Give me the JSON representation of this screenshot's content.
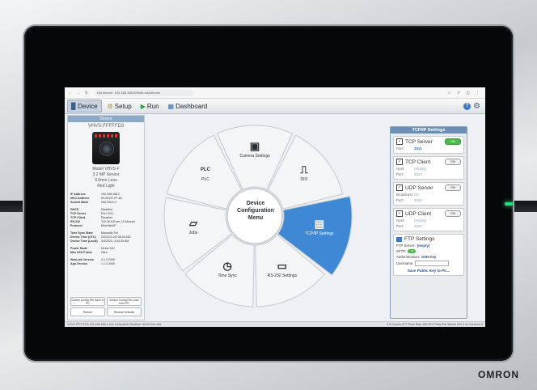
{
  "browser": {
    "url": "192.168.188.2/WebLink/#/home",
    "security": "Not secure"
  },
  "toolbar": {
    "tabs": [
      {
        "label": "Device"
      },
      {
        "label": "Setup"
      },
      {
        "label": "Run"
      },
      {
        "label": "Dashboard"
      }
    ]
  },
  "device": {
    "header": "Device",
    "name": "VHVS-FFFFFD3",
    "model_lines": [
      "Model VHVS-F",
      "3.2 MP Sensor",
      "9.6mm Lens",
      "Red Light"
    ],
    "network": [
      {
        "k": "IP Address",
        "v": "192.168.188.2"
      },
      {
        "k": "MAC Address",
        "v": "00-06-EF-FF-83"
      },
      {
        "k": "Subnet Mask",
        "v": "255.255.0.0"
      }
    ],
    "protocols": [
      {
        "k": "DHCP",
        "v": "Disabled"
      },
      {
        "k": "TCP Server",
        "v": "Port 2011"
      },
      {
        "k": "TCP Client",
        "v": "Disabled"
      },
      {
        "k": "RS-232",
        "v": "115.2K,8,Even,1,Enforced"
      },
      {
        "k": "Protocol",
        "v": "EtherNet/IP"
      }
    ],
    "time": [
      {
        "k": "Time Sync State",
        "v": "Manually Set"
      },
      {
        "k": "Device Time (UTC)",
        "v": "2023-03-04T08:44:45Z"
      },
      {
        "k": "Device Time (Local)",
        "v": "3/4/2023, 3:44:45 AM"
      }
    ],
    "power": [
      {
        "k": "Power Mode",
        "v": "Direct 24V"
      },
      {
        "k": "Max LED Power",
        "v": "Ultra"
      }
    ],
    "versions": [
      {
        "k": "WebLink Version",
        "v": "4.1.5.2006"
      },
      {
        "k": "App Version",
        "v": "1.1.0.3006"
      }
    ],
    "buttons": {
      "save": "Device Config File Save to PC",
      "load": "Device Config File Load from PC",
      "reboot": "Reboot",
      "restore": "Restore Defaults"
    }
  },
  "wheel": {
    "center": "Device Configuration Menu",
    "segments": [
      {
        "label": "Camera Settings"
      },
      {
        "label": "DIO"
      },
      {
        "label": "TCP/IP Settings"
      },
      {
        "label": "RS-232 Settings"
      },
      {
        "label": "Time Sync"
      },
      {
        "label": "Jobs"
      },
      {
        "label": "PLC"
      }
    ],
    "active": "TCP/IP Settings",
    "colors": {
      "active": "#3f88d6",
      "inactive": "#f4f5f6",
      "outline": "#c4c9cf"
    }
  },
  "tcp": {
    "header": "TCP/IP Settings",
    "server": {
      "title": "TCP Server",
      "toggle": "ON",
      "port_label": "Port:",
      "port": "2011"
    },
    "client": {
      "title": "TCP Client",
      "toggle": "Off",
      "host_label": "Host:",
      "host": "(empty)",
      "port_label": "Port:",
      "port": "2023"
    },
    "udp_server": {
      "title": "UDP Server",
      "toggle": "Off",
      "broadcast_label": "Broadcast:",
      "broadcast": "On",
      "port_label": "Port:",
      "port": "2020"
    },
    "udp_client": {
      "title": "UDP Client",
      "toggle": "Off",
      "host_label": "Host:",
      "host": "(empty)",
      "port_label": "Port:",
      "port": "2022"
    },
    "ftp": {
      "title": "FTP Settings",
      "server_label": "FTP Server:",
      "server": "(empty)",
      "sftp_label": "SFTP:",
      "sftp": "On",
      "auth_label": "Authentication:",
      "auth": "SSH Key",
      "user_label": "Username:",
      "save": "Save Public Key to PC..."
    }
  },
  "status": {
    "left": "VHVS-FFFFFD3   192.168.188.2   Job: DefaultJob   Runtime: 00:00 0ms Idle",
    "right": "0 of Cycles 0/??   Pass Rate 100.00%   Parts Per Minute 000   0 of Overruns 0"
  },
  "brand": "OMRON",
  "led_color": "#27e07a"
}
